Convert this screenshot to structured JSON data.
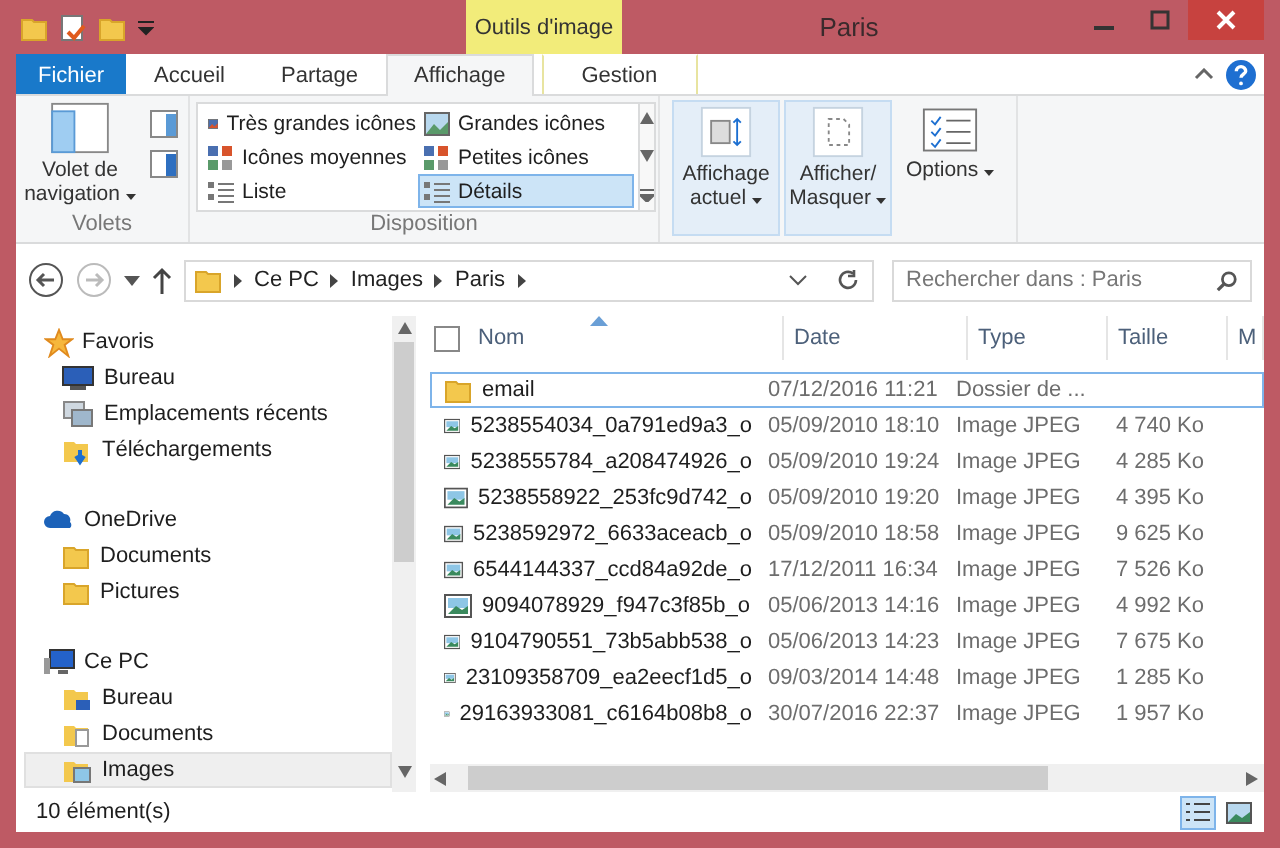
{
  "window": {
    "title": "Paris",
    "contextual_tab": "Outils d'image"
  },
  "tabs": [
    {
      "label": "Fichier",
      "kind": "file",
      "selected": false
    },
    {
      "label": "Accueil",
      "kind": "normal",
      "selected": false
    },
    {
      "label": "Partage",
      "kind": "normal",
      "selected": false
    },
    {
      "label": "Affichage",
      "kind": "normal",
      "selected": true
    },
    {
      "label": "Gestion",
      "kind": "normal",
      "selected": false
    }
  ],
  "ribbon": {
    "panes_group": {
      "label": "Volets",
      "button": "Volet de navigation"
    },
    "layout_group": {
      "label": "Disposition",
      "items": [
        {
          "label": "Très grandes icônes",
          "selected": false
        },
        {
          "label": "Grandes icônes",
          "selected": false
        },
        {
          "label": "Icônes moyennes",
          "selected": false
        },
        {
          "label": "Petites icônes",
          "selected": false
        },
        {
          "label": "Liste",
          "selected": false
        },
        {
          "label": "Détails",
          "selected": true
        }
      ]
    },
    "big_buttons": [
      {
        "label": "Affichage actuel",
        "kind": "sort",
        "framed": true
      },
      {
        "label": "Afficher/ Masquer",
        "kind": "show",
        "framed": true
      },
      {
        "label": "Options",
        "kind": "options",
        "framed": false
      }
    ]
  },
  "address": {
    "path": [
      "Ce PC",
      "Images",
      "Paris"
    ],
    "search_placeholder": "Rechercher dans : Paris"
  },
  "navigation": [
    {
      "label": "Favoris",
      "kind": "star",
      "children": [
        {
          "label": "Bureau",
          "kind": "desktop",
          "selected": false
        },
        {
          "label": "Emplacements récents",
          "kind": "recent",
          "selected": false
        },
        {
          "label": "Téléchargements",
          "kind": "download",
          "selected": false
        }
      ]
    },
    {
      "label": "OneDrive",
      "kind": "cloud",
      "children": [
        {
          "label": "Documents",
          "kind": "folder",
          "selected": false
        },
        {
          "label": "Pictures",
          "kind": "folder",
          "selected": false
        }
      ]
    },
    {
      "label": "Ce PC",
      "kind": "computer",
      "children": [
        {
          "label": "Bureau",
          "kind": "desktop-folder",
          "selected": false
        },
        {
          "label": "Documents",
          "kind": "documents",
          "selected": false
        },
        {
          "label": "Images",
          "kind": "images",
          "selected": true
        }
      ]
    }
  ],
  "table": {
    "select_all_checked": false,
    "columns": [
      "Nom",
      "Date",
      "Type",
      "Taille",
      "M"
    ],
    "rows": [
      {
        "name": "email",
        "date": "07/12/2016 11:21",
        "type": "Dossier de ...",
        "size": "",
        "kind": "folder",
        "focused": true
      },
      {
        "name": "5238554034_0a791ed9a3_o",
        "date": "05/09/2010 18:10",
        "type": "Image JPEG",
        "size": "4 740 Ko",
        "kind": "image",
        "focused": false
      },
      {
        "name": "5238555784_a208474926_o",
        "date": "05/09/2010 19:24",
        "type": "Image JPEG",
        "size": "4 285 Ko",
        "kind": "image",
        "focused": false
      },
      {
        "name": "5238558922_253fc9d742_o",
        "date": "05/09/2010 19:20",
        "type": "Image JPEG",
        "size": "4 395 Ko",
        "kind": "image",
        "focused": false
      },
      {
        "name": "5238592972_6633aceacb_o",
        "date": "05/09/2010 18:58",
        "type": "Image JPEG",
        "size": "9 625 Ko",
        "kind": "image",
        "focused": false
      },
      {
        "name": "6544144337_ccd84a92de_o",
        "date": "17/12/2011 16:34",
        "type": "Image JPEG",
        "size": "7 526 Ko",
        "kind": "image",
        "focused": false
      },
      {
        "name": "9094078929_f947c3f85b_o",
        "date": "05/06/2013 14:16",
        "type": "Image JPEG",
        "size": "4 992 Ko",
        "kind": "image",
        "focused": false
      },
      {
        "name": "9104790551_73b5abb538_o",
        "date": "05/06/2013 14:23",
        "type": "Image JPEG",
        "size": "7 675 Ko",
        "kind": "image",
        "focused": false
      },
      {
        "name": "23109358709_ea2eecf1d5_o",
        "date": "09/03/2014 14:48",
        "type": "Image JPEG",
        "size": "1 285 Ko",
        "kind": "image",
        "focused": false
      },
      {
        "name": "29163933081_c6164b08b8_o",
        "date": "30/07/2016 22:37",
        "type": "Image JPEG",
        "size": "1 957 Ko",
        "kind": "image",
        "focused": false
      }
    ]
  },
  "status_bar": {
    "count": "10 élément(s)",
    "views": [
      {
        "kind": "details",
        "selected": true
      },
      {
        "kind": "large",
        "selected": false
      }
    ]
  }
}
